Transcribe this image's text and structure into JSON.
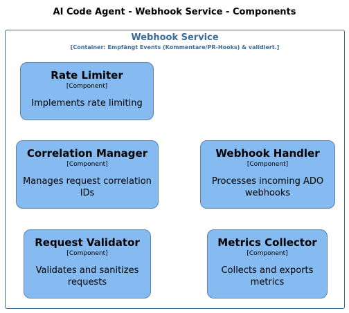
{
  "diagram": {
    "title": "AI Code Agent - Webhook Service - Components",
    "boundary": {
      "title": "Webhook Service",
      "subtitle": "[Container: Empfängt Events (Kommentare/PR-Hooks) & validiert.]"
    },
    "components": {
      "rate_limiter": {
        "name": "Rate Limiter",
        "type": "[Component]",
        "description": "Implements rate limiting"
      },
      "correlation_manager": {
        "name": "Correlation Manager",
        "type": "[Component]",
        "description": "Manages request correlation IDs"
      },
      "webhook_handler": {
        "name": "Webhook Handler",
        "type": "[Component]",
        "description": "Processes incoming ADO webhooks"
      },
      "request_validator": {
        "name": "Request Validator",
        "type": "[Component]",
        "description": "Validates and sanitizes requests"
      },
      "metrics_collector": {
        "name": "Metrics Collector",
        "type": "[Component]",
        "description": "Collects and exports metrics"
      }
    },
    "colors": {
      "component_fill": "#85bbf0",
      "component_border": "#5d82a8",
      "boundary": "#3c6a99"
    }
  }
}
